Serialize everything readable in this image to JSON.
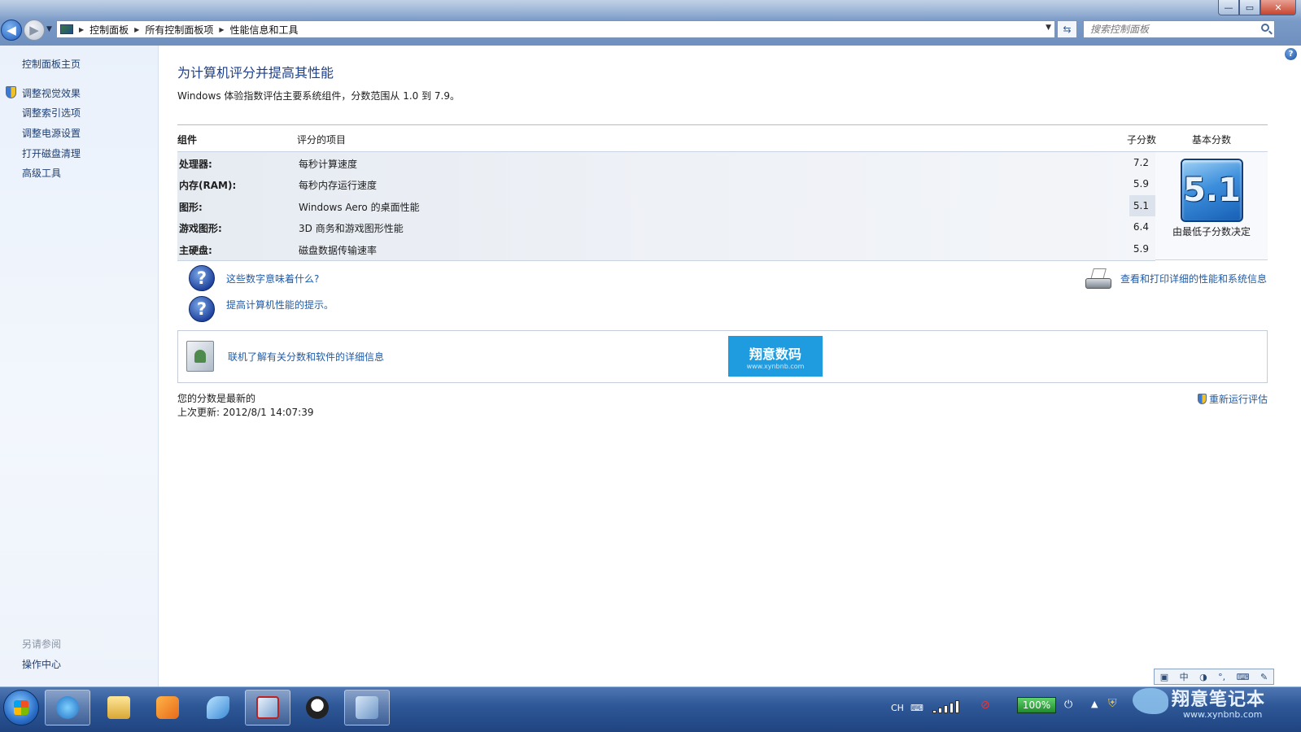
{
  "window": {
    "minimize": "—",
    "maximize": "▭",
    "close": "✕"
  },
  "address_bar": {
    "breadcrumbs": [
      "控制面板",
      "所有控制面板项",
      "性能信息和工具"
    ],
    "search_placeholder": "搜索控制面板"
  },
  "sidebar": {
    "home": "控制面板主页",
    "links": [
      "调整视觉效果",
      "调整索引选项",
      "调整电源设置",
      "打开磁盘清理",
      "高级工具"
    ],
    "see_also_heading": "另请参阅",
    "see_also_links": [
      "操作中心"
    ]
  },
  "main": {
    "title": "为计算机评分并提高其性能",
    "subtitle": "Windows 体验指数评估主要系统组件，分数范围从 1.0 到 7.9。",
    "table": {
      "headers": {
        "component": "组件",
        "rated": "评分的项目",
        "subscore": "子分数",
        "basescore": "基本分数"
      },
      "rows": [
        {
          "component": "处理器:",
          "description": "每秒计算速度",
          "subscore": "7.2"
        },
        {
          "component": "内存(RAM):",
          "description": "每秒内存运行速度",
          "subscore": "5.9"
        },
        {
          "component": "图形:",
          "description": "Windows Aero 的桌面性能",
          "subscore": "5.1"
        },
        {
          "component": "游戏图形:",
          "description": "3D 商务和游戏图形性能",
          "subscore": "6.4"
        },
        {
          "component": "主硬盘:",
          "description": "磁盘数据传输速率",
          "subscore": "5.9"
        }
      ],
      "base_score": "5.1",
      "base_note": "由最低子分数决定"
    },
    "links": {
      "what_numbers_mean": "这些数字意味着什么?",
      "tips": "提高计算机性能的提示。",
      "print_details": "查看和打印详细的性能和系统信息",
      "online_info": "联机了解有关分数和软件的详细信息"
    },
    "logo": {
      "text": "翔意数码",
      "url": "www.xynbnb.com"
    },
    "status": {
      "line1": "您的分数是最新的",
      "line2": "上次更新: 2012/8/1 14:07:39"
    },
    "rerun": "重新运行评估"
  },
  "langbar": [
    "中",
    "CH"
  ],
  "taskbar": {
    "tray_lang": "CH",
    "battery": "100%",
    "watermark_text": "翔意笔记本",
    "watermark_url": "www.xynbnb.com"
  }
}
